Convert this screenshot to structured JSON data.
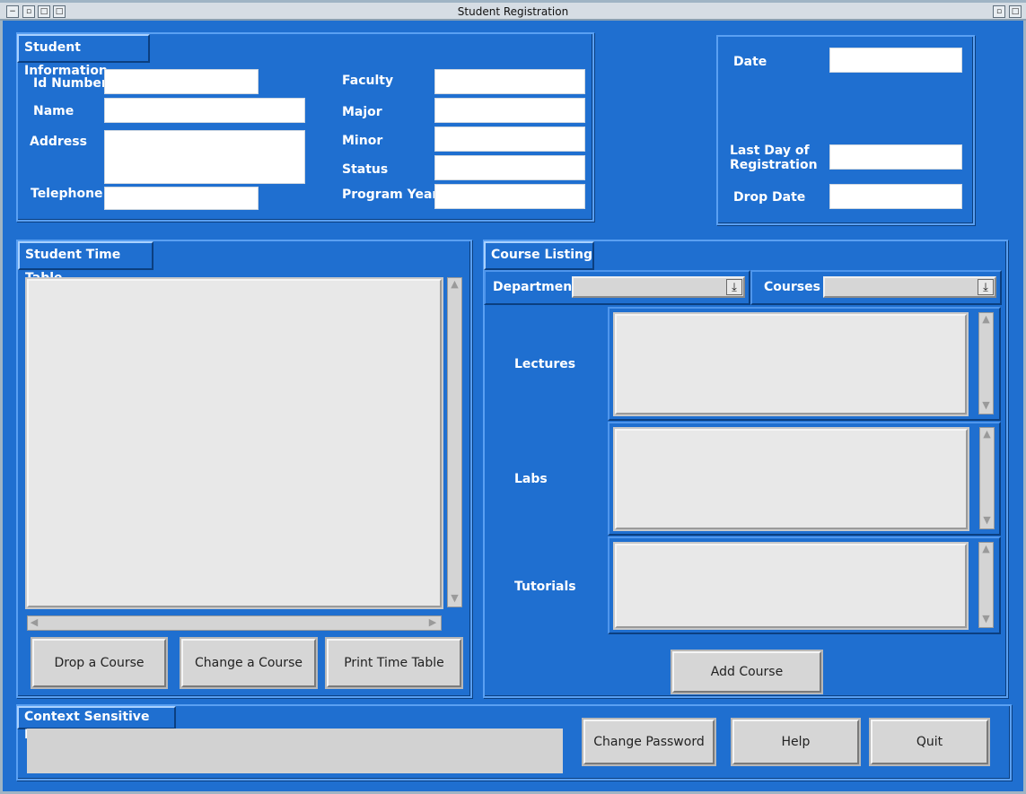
{
  "window": {
    "title": "Student Registration",
    "controls": [
      "minimize-icon",
      "maximize-icon",
      "restore-icon",
      "close-icon"
    ]
  },
  "student_info": {
    "tab": "Student Information",
    "id_number_label": "Id Number",
    "name_label": "Name",
    "address_label": "Address",
    "telephone_label": "Telephone",
    "faculty_label": "Faculty",
    "major_label": "Major",
    "minor_label": "Minor",
    "status_label": "Status",
    "program_year_label": "Program Year",
    "id_number": "",
    "name": "",
    "address": "",
    "telephone": "",
    "faculty": "",
    "major": "",
    "minor": "",
    "status": "",
    "program_year": ""
  },
  "dates": {
    "date_label": "Date",
    "last_day_label": "Last Day of Registration",
    "drop_date_label": "Drop Date",
    "date": "",
    "last_day": "",
    "drop_date": ""
  },
  "timetable": {
    "tab": "Student Time Table",
    "drop_button": "Drop a Course",
    "change_button": "Change a Course",
    "print_button": "Print Time Table"
  },
  "course_listing": {
    "tab": "Course Listing",
    "department_label": "Department",
    "courses_label": "Courses",
    "department_value": "",
    "courses_value": "",
    "lectures_label": "Lectures",
    "labs_label": "Labs",
    "tutorials_label": "Tutorials",
    "add_button": "Add Course"
  },
  "help": {
    "tab": "Context Sensitive Help",
    "text": "",
    "change_password_button": "Change Password",
    "help_button": "Help",
    "quit_button": "Quit"
  },
  "colors": {
    "background": "#1f6fd0",
    "field": "#ffffff",
    "list": "#e8e8e8",
    "button": "#d6d6d6"
  }
}
